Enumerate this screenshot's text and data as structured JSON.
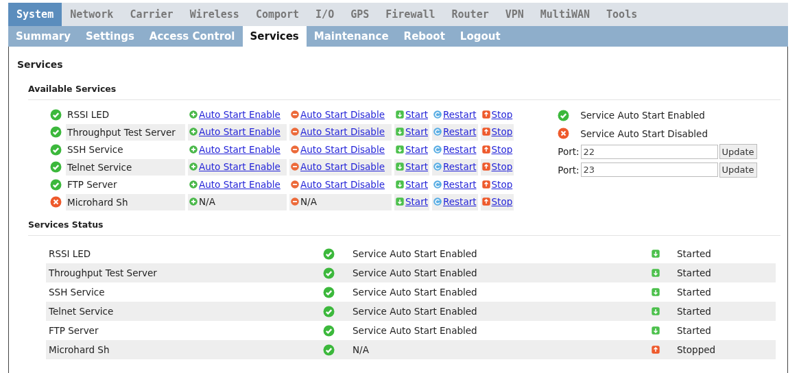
{
  "main_tabs": [
    {
      "label": "System",
      "selected": true
    },
    {
      "label": "Network",
      "selected": false
    },
    {
      "label": "Carrier",
      "selected": false
    },
    {
      "label": "Wireless",
      "selected": false
    },
    {
      "label": "Comport",
      "selected": false
    },
    {
      "label": "I/O",
      "selected": false
    },
    {
      "label": "GPS",
      "selected": false
    },
    {
      "label": "Firewall",
      "selected": false
    },
    {
      "label": "Router",
      "selected": false
    },
    {
      "label": "VPN",
      "selected": false
    },
    {
      "label": "MultiWAN",
      "selected": false
    },
    {
      "label": "Tools",
      "selected": false
    }
  ],
  "sub_tabs": [
    {
      "label": "Summary",
      "selected": false
    },
    {
      "label": "Settings",
      "selected": false
    },
    {
      "label": "Access Control",
      "selected": false
    },
    {
      "label": "Services",
      "selected": true
    },
    {
      "label": "Maintenance",
      "selected": false
    },
    {
      "label": "Reboot",
      "selected": false
    },
    {
      "label": "Logout",
      "selected": false
    }
  ],
  "page_title": "Services",
  "available": {
    "title": "Available Services",
    "rows": [
      {
        "enabled": true,
        "name": "RSSI LED",
        "enable": {
          "text": "Auto Start Enable",
          "link": true
        },
        "disable": {
          "text": "Auto Start Disable",
          "link": true
        },
        "start": "Start",
        "restart": "Restart",
        "stop": "Stop"
      },
      {
        "enabled": true,
        "name": "Throughput Test Server",
        "enable": {
          "text": "Auto Start Enable",
          "link": true
        },
        "disable": {
          "text": "Auto Start Disable",
          "link": true
        },
        "start": "Start",
        "restart": "Restart",
        "stop": "Stop"
      },
      {
        "enabled": true,
        "name": "SSH Service",
        "enable": {
          "text": "Auto Start Enable",
          "link": true
        },
        "disable": {
          "text": "Auto Start Disable",
          "link": true
        },
        "start": "Start",
        "restart": "Restart",
        "stop": "Stop"
      },
      {
        "enabled": true,
        "name": "Telnet Service",
        "enable": {
          "text": "Auto Start Enable",
          "link": true
        },
        "disable": {
          "text": "Auto Start Disable",
          "link": true
        },
        "start": "Start",
        "restart": "Restart",
        "stop": "Stop"
      },
      {
        "enabled": true,
        "name": "FTP Server",
        "enable": {
          "text": "Auto Start Enable",
          "link": true
        },
        "disable": {
          "text": "Auto Start Disable",
          "link": true
        },
        "start": "Start",
        "restart": "Restart",
        "stop": "Stop"
      },
      {
        "enabled": false,
        "name": "Microhard Sh",
        "enable": {
          "text": "N/A",
          "link": false
        },
        "disable": {
          "text": "N/A",
          "link": false
        },
        "start": "Start",
        "restart": "Restart",
        "stop": "Stop"
      }
    ],
    "legend": [
      {
        "enabled": true,
        "text": "Service Auto Start Enabled"
      },
      {
        "enabled": false,
        "text": "Service Auto Start Disabled"
      }
    ],
    "ports": [
      {
        "label": "Port:",
        "value": "22",
        "button": "Update"
      },
      {
        "label": "Port:",
        "value": "23",
        "button": "Update"
      }
    ]
  },
  "status": {
    "title": "Services Status",
    "rows": [
      {
        "name": "RSSI LED",
        "auto_start": true,
        "auto_text": "Service Auto Start Enabled",
        "running": true,
        "run_text": "Started"
      },
      {
        "name": "Throughput Test Server",
        "auto_start": true,
        "auto_text": "Service Auto Start Enabled",
        "running": true,
        "run_text": "Started"
      },
      {
        "name": "SSH Service",
        "auto_start": true,
        "auto_text": "Service Auto Start Enabled",
        "running": true,
        "run_text": "Started"
      },
      {
        "name": "Telnet Service",
        "auto_start": true,
        "auto_text": "Service Auto Start Enabled",
        "running": true,
        "run_text": "Started"
      },
      {
        "name": "FTP Server",
        "auto_start": true,
        "auto_text": "Service Auto Start Enabled",
        "running": true,
        "run_text": "Started"
      },
      {
        "name": "Microhard Sh",
        "auto_start": true,
        "auto_text": "N/A",
        "running": false,
        "run_text": "Stopped"
      }
    ]
  }
}
